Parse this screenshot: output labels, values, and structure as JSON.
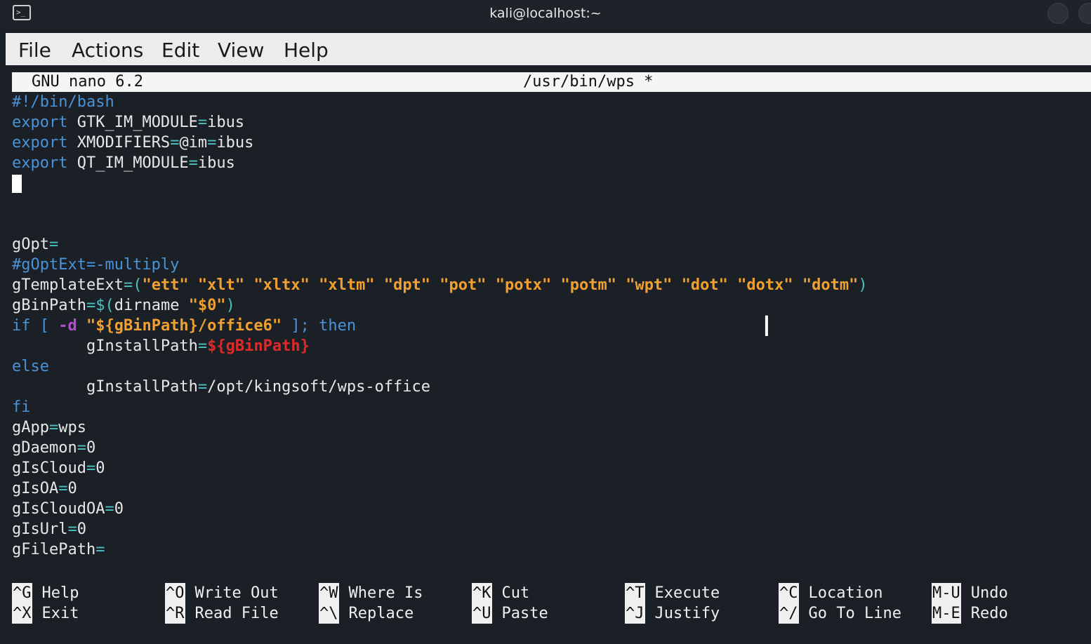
{
  "window": {
    "title": "kali@localhost:~",
    "icon": "terminal-icon"
  },
  "menu": [
    "File",
    "Actions",
    "Edit",
    "View",
    "Help"
  ],
  "nano": {
    "version": "GNU nano 6.2",
    "file": "/usr/bin/wps *"
  },
  "code_lines": [
    [
      {
        "t": "#!/bin/bash",
        "c": "c-comment"
      }
    ],
    [
      {
        "t": "export",
        "c": "c-kw"
      },
      {
        "t": " GTK_IM_MODULE"
      },
      {
        "t": "=",
        "c": "c-op"
      },
      {
        "t": "ibus"
      }
    ],
    [
      {
        "t": "export",
        "c": "c-kw"
      },
      {
        "t": " XMODIFIERS"
      },
      {
        "t": "=",
        "c": "c-op"
      },
      {
        "t": "@im"
      },
      {
        "t": "=",
        "c": "c-op"
      },
      {
        "t": "ibus"
      }
    ],
    [
      {
        "t": "export",
        "c": "c-kw"
      },
      {
        "t": " QT_IM_MODULE"
      },
      {
        "t": "=",
        "c": "c-op"
      },
      {
        "t": "ibus"
      }
    ],
    [
      {
        "cursor": true
      }
    ],
    [],
    [],
    [
      {
        "t": "gOpt"
      },
      {
        "t": "=",
        "c": "c-op"
      }
    ],
    [
      {
        "t": "#gOptExt=-multiply",
        "c": "c-comment"
      }
    ],
    [
      {
        "t": "gTemplateExt"
      },
      {
        "t": "=(",
        "c": "c-op"
      },
      {
        "t": "\"ett\" \"xlt\" \"xltx\" \"xltm\" \"dpt\" \"pot\" \"potx\" \"potm\" \"wpt\" \"dot\" \"dotx\" \"dotm\"",
        "c": "c-str"
      },
      {
        "t": ")",
        "c": "c-op"
      }
    ],
    [
      {
        "t": "gBinPath"
      },
      {
        "t": "=$(",
        "c": "c-op"
      },
      {
        "t": "dirname "
      },
      {
        "t": "\"$0\"",
        "c": "c-str"
      },
      {
        "t": ")",
        "c": "c-op"
      }
    ],
    [
      {
        "t": "if [ ",
        "c": "c-kw"
      },
      {
        "t": "-d",
        "c": "c-flag"
      },
      {
        "t": " "
      },
      {
        "t": "\"${gBinPath}/office6\"",
        "c": "c-str"
      },
      {
        "t": " ]; then",
        "c": "c-kw"
      }
    ],
    [
      {
        "t": "        gInstallPath"
      },
      {
        "t": "=",
        "c": "c-op"
      },
      {
        "t": "${gBinPath}",
        "c": "c-var"
      }
    ],
    [
      {
        "t": "else",
        "c": "c-kw"
      }
    ],
    [
      {
        "t": "        gInstallPath"
      },
      {
        "t": "=",
        "c": "c-op"
      },
      {
        "t": "/opt/kingsoft/wps-office"
      }
    ],
    [
      {
        "t": "fi",
        "c": "c-kw"
      }
    ],
    [
      {
        "t": "gApp"
      },
      {
        "t": "=",
        "c": "c-op"
      },
      {
        "t": "wps"
      }
    ],
    [
      {
        "t": "gDaemon"
      },
      {
        "t": "=",
        "c": "c-op"
      },
      {
        "t": "0"
      }
    ],
    [
      {
        "t": "gIsCloud"
      },
      {
        "t": "=",
        "c": "c-op"
      },
      {
        "t": "0"
      }
    ],
    [
      {
        "t": "gIsOA"
      },
      {
        "t": "=",
        "c": "c-op"
      },
      {
        "t": "0"
      }
    ],
    [
      {
        "t": "gIsCloudOA"
      },
      {
        "t": "=",
        "c": "c-op"
      },
      {
        "t": "0"
      }
    ],
    [
      {
        "t": "gIsUrl"
      },
      {
        "t": "=",
        "c": "c-op"
      },
      {
        "t": "0"
      }
    ],
    [
      {
        "t": "gFilePath"
      },
      {
        "t": "=",
        "c": "c-op"
      }
    ]
  ],
  "shortcuts": [
    {
      "key": "^G",
      "label": "Help"
    },
    {
      "key": "^O",
      "label": "Write Out"
    },
    {
      "key": "^W",
      "label": "Where Is"
    },
    {
      "key": "^K",
      "label": "Cut"
    },
    {
      "key": "^T",
      "label": "Execute"
    },
    {
      "key": "^C",
      "label": "Location"
    },
    {
      "key": "M-U",
      "label": "Undo"
    },
    {
      "key": "^X",
      "label": "Exit"
    },
    {
      "key": "^R",
      "label": "Read File"
    },
    {
      "key": "^\\",
      "label": "Replace"
    },
    {
      "key": "^U",
      "label": "Paste"
    },
    {
      "key": "^J",
      "label": "Justify"
    },
    {
      "key": "^/",
      "label": "Go To Line"
    },
    {
      "key": "M-E",
      "label": "Redo"
    }
  ]
}
